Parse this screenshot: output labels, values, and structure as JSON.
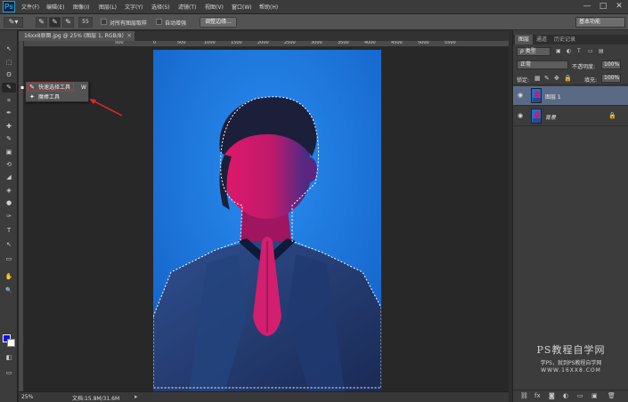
{
  "app": {
    "logo": "Ps"
  },
  "menu": [
    "文件(F)",
    "编辑(E)",
    "图像(I)",
    "图层(L)",
    "文字(Y)",
    "选择(S)",
    "滤镜(T)",
    "视图(V)",
    "窗口(W)",
    "帮助(H)"
  ],
  "window_controls": {
    "minimize": "—",
    "maximize": "□",
    "close": "✕"
  },
  "options": {
    "brush_size": "55",
    "sample_all_layers": "对所有图层取样",
    "auto_enhance": "自动增强",
    "refine_edge": "调整边缘...",
    "workspace": "基本功能"
  },
  "tools": [
    "↖",
    "⬚",
    "ʘ",
    "✎",
    "⌗",
    "✒",
    "✚",
    "✎",
    "▣",
    "⟲",
    "◢",
    "◈",
    "●",
    "✑",
    "T",
    "↖",
    "▭",
    "✋",
    "🔍",
    "◧",
    "▭",
    "▭"
  ],
  "document": {
    "tab_title": "16xx8原图.jpg @ 25% (图层 1, RGB/8)",
    "tab_close": "×"
  },
  "ruler": {
    "h_labels": [
      "500",
      "0",
      "500",
      "1000",
      "1500",
      "2000",
      "2500",
      "3000",
      "3500",
      "4000",
      "4500",
      "5000",
      "5500"
    ]
  },
  "flyout": {
    "items": [
      {
        "label": "快速选择工具",
        "key": "W",
        "icon": "✎"
      },
      {
        "label": "魔棒工具",
        "key": "W",
        "icon": "✦"
      }
    ]
  },
  "status": {
    "zoom": "25%",
    "doc_info": "文档:15.8M/31.6M",
    "arrow": "▸"
  },
  "panel": {
    "tabs": [
      "图层",
      "通道",
      "历史记录"
    ],
    "filter_kind": "ρ 类型",
    "blend_mode": "正常",
    "opacity_label": "不透明度:",
    "opacity_value": "100%",
    "lock_label": "锁定:",
    "fill_label": "填充:",
    "fill_value": "100%",
    "layers": [
      {
        "name": "图层 1",
        "selected": true,
        "locked": false
      },
      {
        "name": "背景",
        "selected": false,
        "locked": true
      }
    ]
  },
  "watermark": {
    "title": "PS教程自学网",
    "subtitle": "学PS，就到PS教程自学网",
    "url": "WWW.16XX8.COM"
  },
  "colors": {
    "foreground": "#0a10e8",
    "background": "#ffffff",
    "highlight": "#e0262a",
    "photo_bg": "#1a86e6"
  }
}
